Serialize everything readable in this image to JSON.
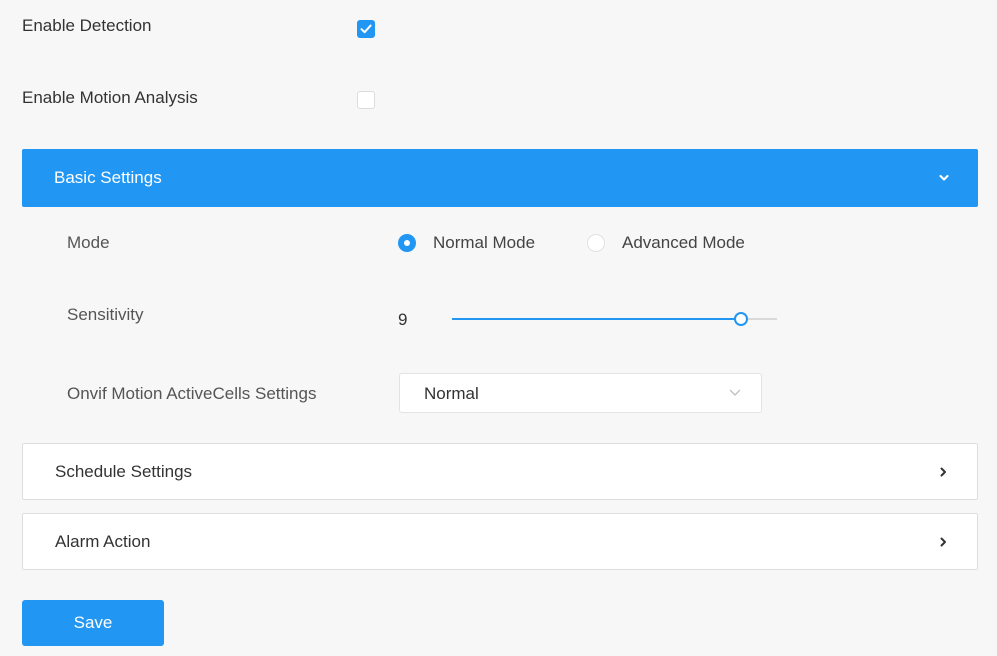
{
  "detection": {
    "enable_detection_label": "Enable Detection",
    "enable_detection_checked": true,
    "enable_motion_analysis_label": "Enable Motion Analysis",
    "enable_motion_analysis_checked": false
  },
  "basic_settings": {
    "title": "Basic Settings",
    "expanded": true,
    "mode": {
      "label": "Mode",
      "options": [
        "Normal Mode",
        "Advanced Mode"
      ],
      "selected": "Normal Mode"
    },
    "sensitivity": {
      "label": "Sensitivity",
      "value": "9",
      "fraction": 0.89
    },
    "onvif": {
      "label": "Onvif Motion ActiveCells Settings",
      "value": "Normal"
    }
  },
  "schedule_settings": {
    "title": "Schedule Settings",
    "expanded": false
  },
  "alarm_action": {
    "title": "Alarm Action",
    "expanded": false
  },
  "save_label": "Save",
  "colors": {
    "accent": "#2196f3",
    "background": "#f7f7f7",
    "panel": "#ffffff",
    "border": "#dedede",
    "text": "#333333"
  },
  "icons": {
    "checked": "check-icon",
    "expanded": "chevron-down-icon",
    "collapsed": "chevron-right-icon",
    "select": "chevron-down-icon"
  }
}
